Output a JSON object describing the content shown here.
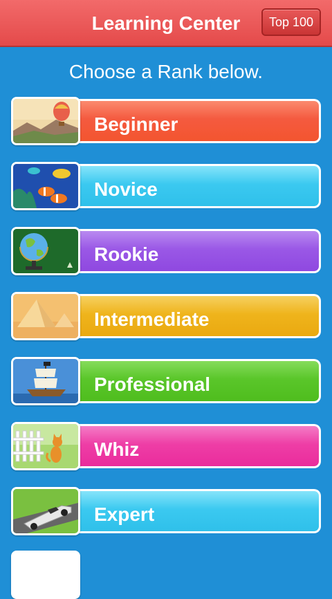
{
  "header": {
    "title": "Learning Center",
    "top_button": "Top 100"
  },
  "subtitle": "Choose a Rank below.",
  "ranks": [
    {
      "label": "Beginner",
      "color": "#f8604a",
      "icon": "hot-air-balloon-icon"
    },
    {
      "label": "Novice",
      "color": "#3ccdf2",
      "icon": "fish-icon"
    },
    {
      "label": "Rookie",
      "color": "#9b55e6",
      "icon": "globe-icon"
    },
    {
      "label": "Intermediate",
      "color": "#f0b820",
      "icon": "pyramid-icon"
    },
    {
      "label": "Professional",
      "color": "#58c528",
      "icon": "ship-icon"
    },
    {
      "label": "Whiz",
      "color": "#ee3da8",
      "icon": "cat-icon"
    },
    {
      "label": "Expert",
      "color": "#3ccdf2",
      "icon": "race-car-icon"
    }
  ]
}
